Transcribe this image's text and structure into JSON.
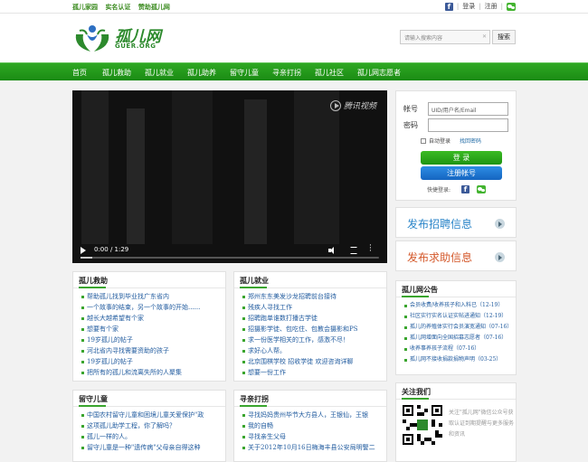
{
  "topbar": {
    "links": [
      "孤儿家园",
      "实名认证",
      "赞助孤儿网"
    ],
    "login": "登录",
    "register": "注册"
  },
  "header": {
    "logo_cn": "孤儿网",
    "logo_en": "GUER.ORG",
    "search_placeholder": "请输入搜索内容",
    "search_button": "搜索"
  },
  "nav": [
    "首页",
    "孤儿救助",
    "孤儿就业",
    "孤儿助养",
    "留守儿童",
    "寻亲打拐",
    "孤儿社区",
    "孤儿网志愿者"
  ],
  "video": {
    "brand": "腾讯视频",
    "time": "0:00 / 1:29",
    "progress": 0.04
  },
  "login": {
    "account_label": "帐号",
    "account_placeholder": "UID/用户名/Email",
    "password_label": "密码",
    "remember": "自动登录",
    "forgot": "找回密码",
    "login_button": "登 录",
    "register_button": "注册帐号",
    "quick_login": "快捷登录:"
  },
  "promos": {
    "hire": "发布招聘信息",
    "job": "发布求助信息"
  },
  "rescue": {
    "title": "孤儿救助",
    "items": [
      "帮助孤儿找到毕业找广东省内",
      "一个故事的结束，另一个故事的开始......",
      "越长大越希望有个家",
      "想要有个家",
      "19岁孤儿的帖子",
      "河北省内寻找需要资助的孩子",
      "19岁孤儿的帖子",
      "把所有的孤儿和流离失所的人聚集"
    ]
  },
  "employ": {
    "title": "孤儿就业",
    "items": [
      "郑州东东美发沙龙招聘前台接待",
      "残疾人寻找工作",
      "招聘跑单谁数打播古学徒",
      "招摄影学徒、包吃住、包教会摄影和PS",
      "求一份医学相关的工作，感激不尽！",
      "求好心人帮。",
      "北京围棋学校 招收学徒 欢迎咨询详聊",
      "想要一份工作"
    ]
  },
  "notice": {
    "title": "孤儿网公告",
    "items": [
      "会员收费/收养孩子和入料已（12-19）",
      "社区实行实名认证实帖进通知（12-19）",
      "孤儿的养殖体实行会员演宽通知（07-16）",
      "孤儿网增面向全国招募志愿者（07-16）",
      "收养事养孩子流程（07-16）",
      "孤儿网不接收捐款捐物声明（03-25）"
    ]
  },
  "left_behind": {
    "title": "留守儿童",
    "items": [
      "中国农村留守儿童和困境儿童关爱保护\"政",
      "这项孤儿助学工程，你了解吗？",
      "孤儿一样的人。",
      "留守儿童是一种\"遗传病\"父母亲自得这种"
    ]
  },
  "search_family": {
    "title": "寻亲打拐",
    "items": [
      "寻找妈妈贵州毕节大方县人，王银仙，王银",
      "我的自畅",
      "寻找亲生父母",
      "关于2012年10月16日梅海丰县公安局明警二"
    ]
  },
  "follow": {
    "title": "关注我们",
    "text": "关注\"孤儿网\"微信公众号获取认证到期提醒与更多服务和资讯"
  }
}
